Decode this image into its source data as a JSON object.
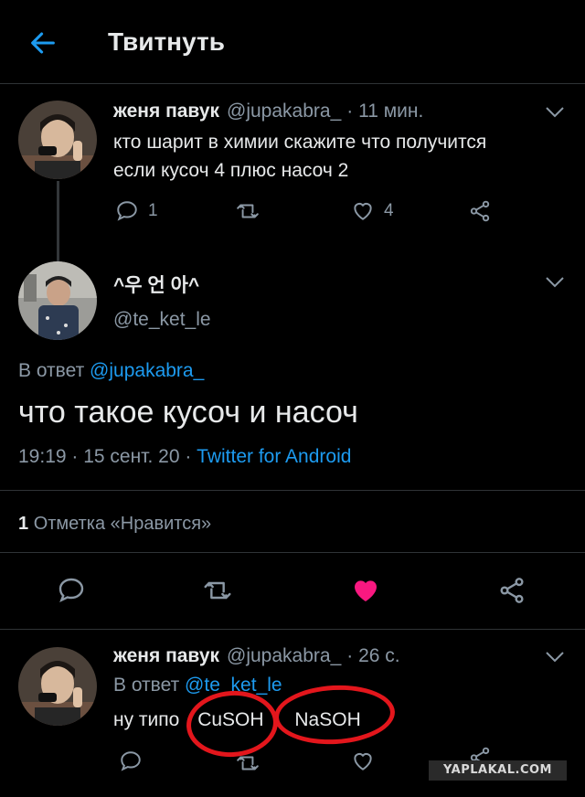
{
  "header": {
    "title": "Твитнуть"
  },
  "tweet1": {
    "name": "женя павук",
    "handle": "@jupakabra_",
    "time": "· 11 мин.",
    "text_line1": "кто шарит в химии скажите что получится",
    "text_line2": "если кусоч 4 плюс насоч 2",
    "replies": "1",
    "likes": "4"
  },
  "tweet2": {
    "name": "^우 언 아^",
    "handle": "@te_ket_le",
    "reply_prefix": "В ответ",
    "reply_to": "@jupakabra_",
    "text": "что такое кусоч и насоч",
    "time": "19:19 · 15 сент. 20 ·",
    "client": "Twitter for Android",
    "likes_count": "1",
    "likes_label": "Отметка «Нравится»"
  },
  "tweet3": {
    "name": "женя павук",
    "handle": "@jupakabra_",
    "time": "· 26 с.",
    "reply_prefix": "В ответ",
    "reply_to": "@te_ket_le",
    "text_prefix": "ну типо",
    "formula1": "CuSOH",
    "formula2": "NaSOH"
  },
  "watermark": "YAPLAKAL.COM",
  "colors": {
    "accent": "#1d9bf0",
    "like": "#f91880",
    "annotation": "#e3161c"
  }
}
